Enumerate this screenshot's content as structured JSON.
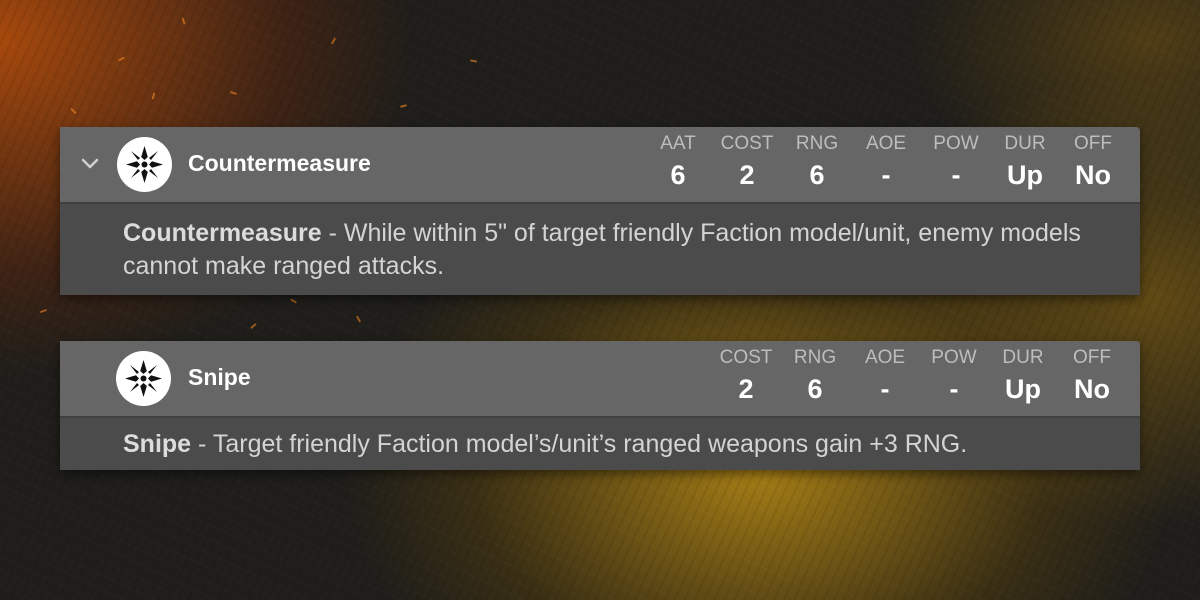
{
  "colors": {
    "header_bg": "#666666",
    "description_bg": "#4b4b4b",
    "label_text": "#bdbdbd",
    "value_text": "#ffffff"
  },
  "cards": [
    {
      "expanded": true,
      "icon": "faction-emblem-icon",
      "title": "Countermeasure",
      "stats": [
        {
          "label": "AAT",
          "value": "6"
        },
        {
          "label": "COST",
          "value": "2"
        },
        {
          "label": "RNG",
          "value": "6"
        },
        {
          "label": "AOE",
          "value": "-"
        },
        {
          "label": "POW",
          "value": "-"
        },
        {
          "label": "DUR",
          "value": "Up"
        },
        {
          "label": "OFF",
          "value": "No"
        }
      ],
      "description_name": "Countermeasure",
      "description_text": " - While within 5\" of target friendly Faction model/unit, enemy models cannot make ranged attacks."
    },
    {
      "expanded": false,
      "icon": "faction-emblem-icon",
      "title": "Snipe",
      "stats": [
        {
          "label": "COST",
          "value": "2"
        },
        {
          "label": "RNG",
          "value": "6"
        },
        {
          "label": "AOE",
          "value": "-"
        },
        {
          "label": "POW",
          "value": "-"
        },
        {
          "label": "DUR",
          "value": "Up"
        },
        {
          "label": "OFF",
          "value": "No"
        }
      ],
      "description_name": "Snipe",
      "description_text": " - Target friendly Faction model’s/unit’s ranged weapons gain +3 RNG."
    }
  ]
}
